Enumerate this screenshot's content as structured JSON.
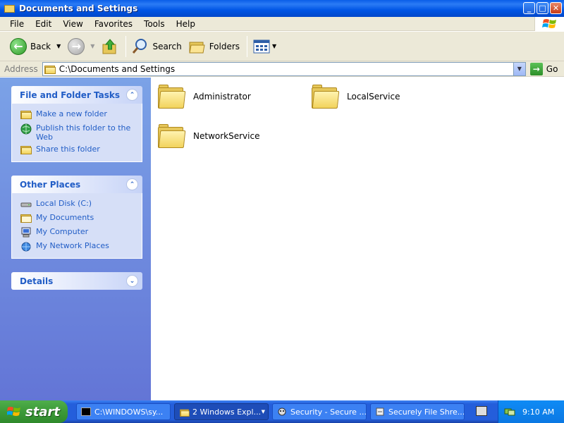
{
  "window": {
    "title": "Documents and Settings"
  },
  "menu": [
    "File",
    "Edit",
    "View",
    "Favorites",
    "Tools",
    "Help"
  ],
  "toolbar": {
    "back": "Back",
    "search": "Search",
    "folders": "Folders"
  },
  "address": {
    "label": "Address",
    "value": "C:\\Documents and Settings",
    "go": "Go"
  },
  "tasks_panel": {
    "title": "File and Folder Tasks",
    "items": [
      "Make a new folder",
      "Publish this folder to the Web",
      "Share this folder"
    ]
  },
  "places_panel": {
    "title": "Other Places",
    "items": [
      "Local Disk (C:)",
      "My Documents",
      "My Computer",
      "My Network Places"
    ]
  },
  "details_panel": {
    "title": "Details"
  },
  "folders": [
    "Administrator",
    "LocalService",
    "NetworkService"
  ],
  "taskbar": {
    "start": "start",
    "tasks": [
      "C:\\WINDOWS\\sy...",
      "2 Windows Expl...",
      "Security - Secure ...",
      "Securely File Shre..."
    ],
    "clock": "9:10 AM"
  }
}
